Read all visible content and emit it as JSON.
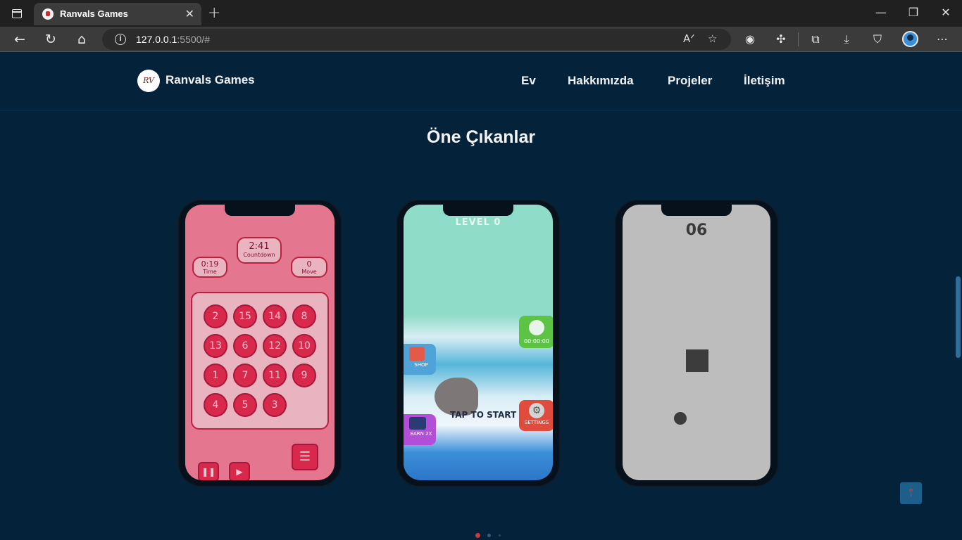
{
  "browser": {
    "tab_title": "Ranvals Games",
    "url_host": "127.0.0.1",
    "url_rest": ":5500/#"
  },
  "site": {
    "brand": "Ranvals Games",
    "logo_text": "RV",
    "nav": [
      "Ev",
      "Hakkımızda",
      "Projeler",
      "İletişim"
    ],
    "section_title": "Öne Çıkanlar"
  },
  "phone1": {
    "countdown_value": "2:41",
    "countdown_label": "Countdown",
    "time_value": "0:19",
    "time_label": "Time",
    "move_value": "0",
    "move_label": "Move",
    "tiles": [
      "2",
      "15",
      "14",
      "8",
      "13",
      "6",
      "12",
      "10",
      "1",
      "7",
      "11",
      "9",
      "4",
      "5",
      "3"
    ]
  },
  "phone2": {
    "level": "LEVEL 0",
    "timer": "00:00:00",
    "shop": "SHOP",
    "earn": "EARN 2X",
    "settings": "SETTINGS",
    "tap": "TAP TO START"
  },
  "phone3": {
    "score": "06"
  },
  "colors": {
    "page_bg": "#04223a",
    "accent_red": "#c43b3b"
  }
}
